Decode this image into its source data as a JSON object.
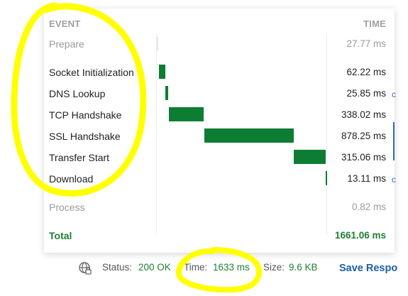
{
  "timing": {
    "header_event": "EVENT",
    "header_time": "TIME",
    "rows": [
      {
        "label": "Prepare",
        "time": "27.77 ms",
        "muted": true,
        "ms": 27.77
      },
      {
        "label": "Socket Initialization",
        "time": "62.22 ms",
        "muted": false,
        "ms": 62.22
      },
      {
        "label": "DNS Lookup",
        "time": "25.85 ms",
        "muted": false,
        "ms": 25.85
      },
      {
        "label": "TCP Handshake",
        "time": "338.02 ms",
        "muted": false,
        "ms": 338.02
      },
      {
        "label": "SSL Handshake",
        "time": "878.25 ms",
        "muted": false,
        "ms": 878.25
      },
      {
        "label": "Transfer Start",
        "time": "315.06 ms",
        "muted": false,
        "ms": 315.06
      },
      {
        "label": "Download",
        "time": "13.11 ms",
        "muted": false,
        "ms": 13.11
      },
      {
        "label": "Process",
        "time": "0.82 ms",
        "muted": true,
        "ms": 0.82
      }
    ],
    "total_label": "Total",
    "total_time": "1661.06 ms",
    "bar_color": "#0d7d34"
  },
  "footer": {
    "globe_icon": "globe-lock-icon",
    "status_label": "Status:",
    "status_value": "200 OK",
    "time_label": "Time:",
    "time_value": "1633 ms",
    "size_label": "Size:",
    "size_value": "9.6 KB",
    "save_label": "Save Respo"
  },
  "annotation_color": "#ffff00"
}
